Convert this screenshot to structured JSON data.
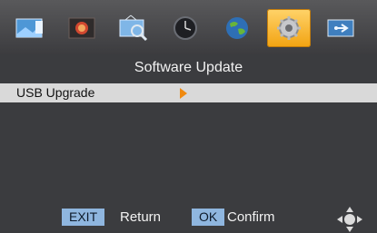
{
  "menu": {
    "icons": [
      {
        "name": "picture-icon",
        "selected": false
      },
      {
        "name": "image-icon",
        "selected": false
      },
      {
        "name": "search-channel-icon",
        "selected": false
      },
      {
        "name": "clock-icon",
        "selected": false
      },
      {
        "name": "globe-icon",
        "selected": false
      },
      {
        "name": "settings-gear-icon",
        "selected": true
      },
      {
        "name": "usb-icon",
        "selected": false
      }
    ]
  },
  "page": {
    "title": "Software Update"
  },
  "list": {
    "items": [
      {
        "label": "USB Upgrade"
      }
    ]
  },
  "footer": {
    "exit_key": "EXIT",
    "exit_label": "Return",
    "ok_key": "OK",
    "ok_label": "Confirm",
    "nav_icon": "navigation-arrows-icon"
  },
  "colors": {
    "accent": "#f08a10",
    "key_bg": "#8fb6df"
  }
}
